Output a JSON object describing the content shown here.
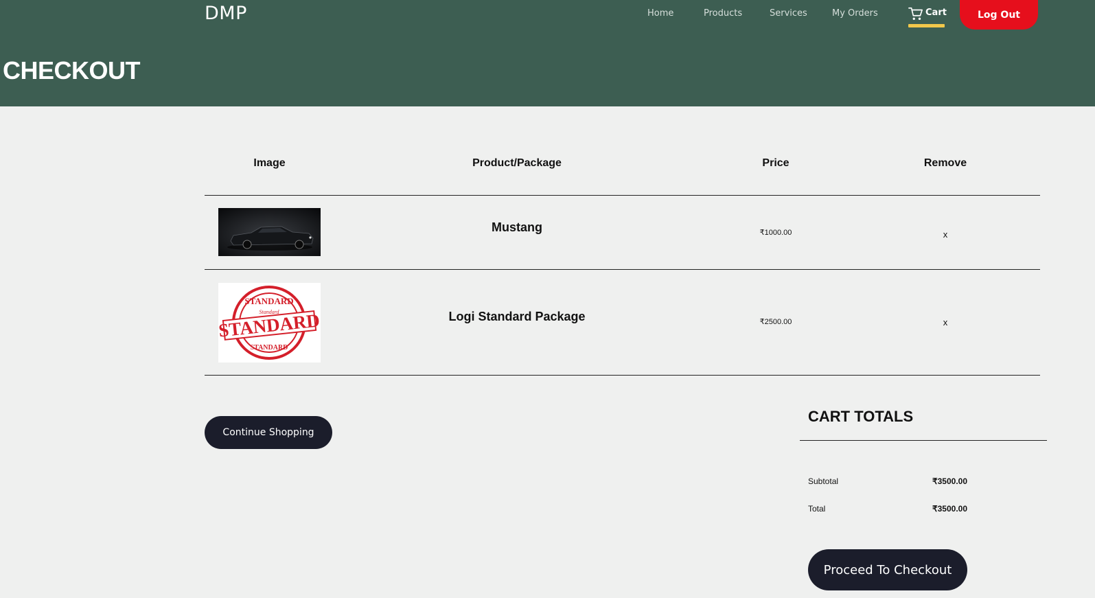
{
  "header": {
    "logo": "DMP",
    "nav": [
      "Home",
      "Products",
      "Services",
      "My Orders"
    ],
    "cart_label": "Cart",
    "logout_label": "Log Out",
    "page_title": "CHECKOUT"
  },
  "table": {
    "columns": [
      "Image",
      "Product/Package",
      "Price",
      "Remove"
    ],
    "rows": [
      {
        "name": "Mustang",
        "price": "₹1000.00",
        "remove": "x"
      },
      {
        "name": "Logi Standard Package",
        "price": "₹2500.00",
        "remove": "x"
      }
    ],
    "stamp_text": [
      "STANDARD",
      "Standard",
      "STANDARD",
      "STANDARD"
    ]
  },
  "continue_label": "Continue Shopping",
  "totals": {
    "title": "CART TOTALS",
    "subtotal_label": "Subtotal",
    "subtotal_value": "₹3500.00",
    "total_label": "Total",
    "total_value": "₹3500.00",
    "checkout_label": "Proceed To Checkout"
  },
  "colors": {
    "header_bg": "#3d5e52",
    "logout_bg": "#e60f1c",
    "button_dark": "#1b1d2b",
    "cart_underline": "#f2c84b"
  }
}
